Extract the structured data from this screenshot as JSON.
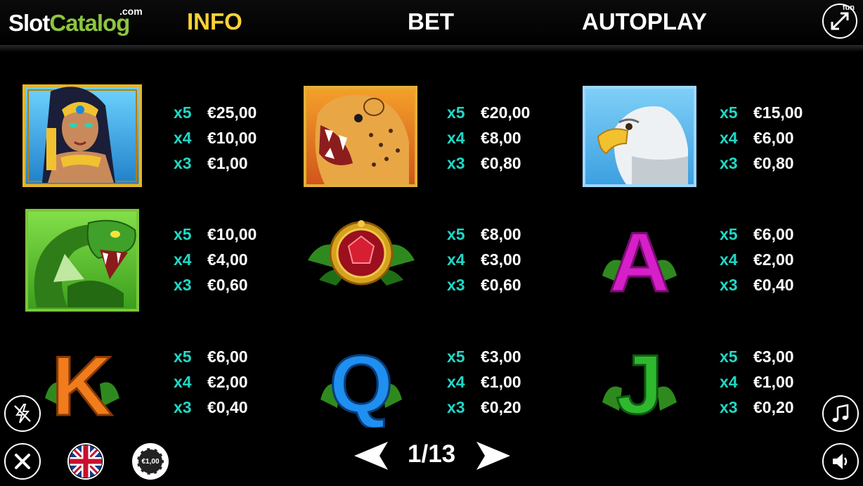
{
  "logo": {
    "slot": "Slot",
    "catalog": "Catalog",
    "com": ".com"
  },
  "tabs": {
    "info": "INFO",
    "bet": "BET",
    "autoplay": "AUTOPLAY"
  },
  "fullscreen": {
    "badge": "fun",
    "icon": "expand-arrows-icon"
  },
  "colors": {
    "active_tab": "#ffd234",
    "multiplier": "#1fd8c7",
    "logo_green": "#8cc63f"
  },
  "paytable": [
    {
      "symbol": "cleopatra",
      "rows": [
        {
          "mult": "x5",
          "val": "€25,00"
        },
        {
          "mult": "x4",
          "val": "€10,00"
        },
        {
          "mult": "x3",
          "val": "€1,00"
        }
      ]
    },
    {
      "symbol": "leopard",
      "rows": [
        {
          "mult": "x5",
          "val": "€20,00"
        },
        {
          "mult": "x4",
          "val": "€8,00"
        },
        {
          "mult": "x3",
          "val": "€0,80"
        }
      ]
    },
    {
      "symbol": "eagle",
      "rows": [
        {
          "mult": "x5",
          "val": "€15,00"
        },
        {
          "mult": "x4",
          "val": "€6,00"
        },
        {
          "mult": "x3",
          "val": "€0,80"
        }
      ]
    },
    {
      "symbol": "snake",
      "rows": [
        {
          "mult": "x5",
          "val": "€10,00"
        },
        {
          "mult": "x4",
          "val": "€4,00"
        },
        {
          "mult": "x3",
          "val": "€0,60"
        }
      ]
    },
    {
      "symbol": "ruby-gem",
      "rows": [
        {
          "mult": "x5",
          "val": "€8,00"
        },
        {
          "mult": "x4",
          "val": "€3,00"
        },
        {
          "mult": "x3",
          "val": "€0,60"
        }
      ]
    },
    {
      "symbol": "letter-A",
      "rows": [
        {
          "mult": "x5",
          "val": "€6,00"
        },
        {
          "mult": "x4",
          "val": "€2,00"
        },
        {
          "mult": "x3",
          "val": "€0,40"
        }
      ]
    },
    {
      "symbol": "letter-K",
      "rows": [
        {
          "mult": "x5",
          "val": "€6,00"
        },
        {
          "mult": "x4",
          "val": "€2,00"
        },
        {
          "mult": "x3",
          "val": "€0,40"
        }
      ]
    },
    {
      "symbol": "letter-Q",
      "rows": [
        {
          "mult": "x5",
          "val": "€3,00"
        },
        {
          "mult": "x4",
          "val": "€1,00"
        },
        {
          "mult": "x3",
          "val": "€0,20"
        }
      ]
    },
    {
      "symbol": "letter-J",
      "rows": [
        {
          "mult": "x5",
          "val": "€3,00"
        },
        {
          "mult": "x4",
          "val": "€1,00"
        },
        {
          "mult": "x3",
          "val": "€0,20"
        }
      ]
    }
  ],
  "letters": {
    "a": "A",
    "k": "K",
    "q": "Q",
    "j": "J"
  },
  "bottom": {
    "chip_value": "€1,00",
    "page": "1/13",
    "icons": [
      "turbo-off-icon",
      "close-icon",
      "uk-flag-icon",
      "bet-chip-icon",
      "prev-arrow-icon",
      "next-arrow-icon",
      "music-icon",
      "sound-icon"
    ]
  }
}
